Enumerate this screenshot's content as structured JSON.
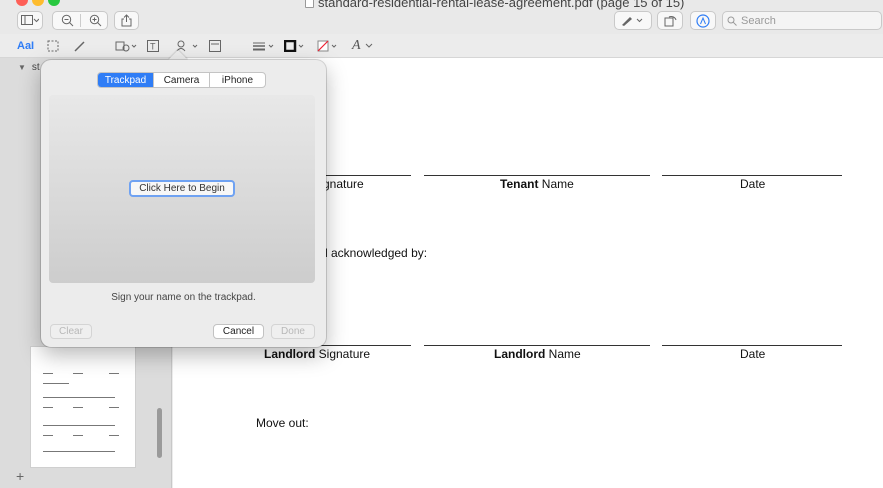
{
  "window": {
    "title": "standard-residential-rental-lease-agreement.pdf (page 15 of 15)"
  },
  "toolbar": {
    "search_placeholder": "Search",
    "icons": [
      "sidebar-toggle-icon",
      "zoom-out-icon",
      "zoom-in-icon",
      "share-icon",
      "pen-icon",
      "rotate-icon",
      "markup-icon",
      "search-icon"
    ]
  },
  "markup_toolbar": {
    "text_style": "AaI",
    "font_icon": "A"
  },
  "sidebar": {
    "header": "st"
  },
  "document": {
    "row1": {
      "col1_bold": "",
      "col1_text": "gnature",
      "col2_bold": "Tenant",
      "col2_text": " Name",
      "col3_text": "Date"
    },
    "acknowledged_text": "d acknowledged by:",
    "row2": {
      "col1_bold": "Landlord",
      "col1_text": " Signature",
      "col2_bold": "Landlord",
      "col2_text": " Name",
      "col3_text": "Date"
    },
    "move_out": "Move out:"
  },
  "signature_popover": {
    "tabs": [
      {
        "label": "Trackpad",
        "active": true
      },
      {
        "label": "Camera",
        "active": false
      },
      {
        "label": "iPhone",
        "active": false
      }
    ],
    "begin_button": "Click Here to Begin",
    "hint": "Sign your name on the trackpad.",
    "clear_button": "Clear",
    "cancel_button": "Cancel",
    "done_button": "Done"
  },
  "colors": {
    "accent": "#2f7df6",
    "close": "#fe5f57",
    "minimize": "#febc2e",
    "zoom": "#28c840"
  }
}
